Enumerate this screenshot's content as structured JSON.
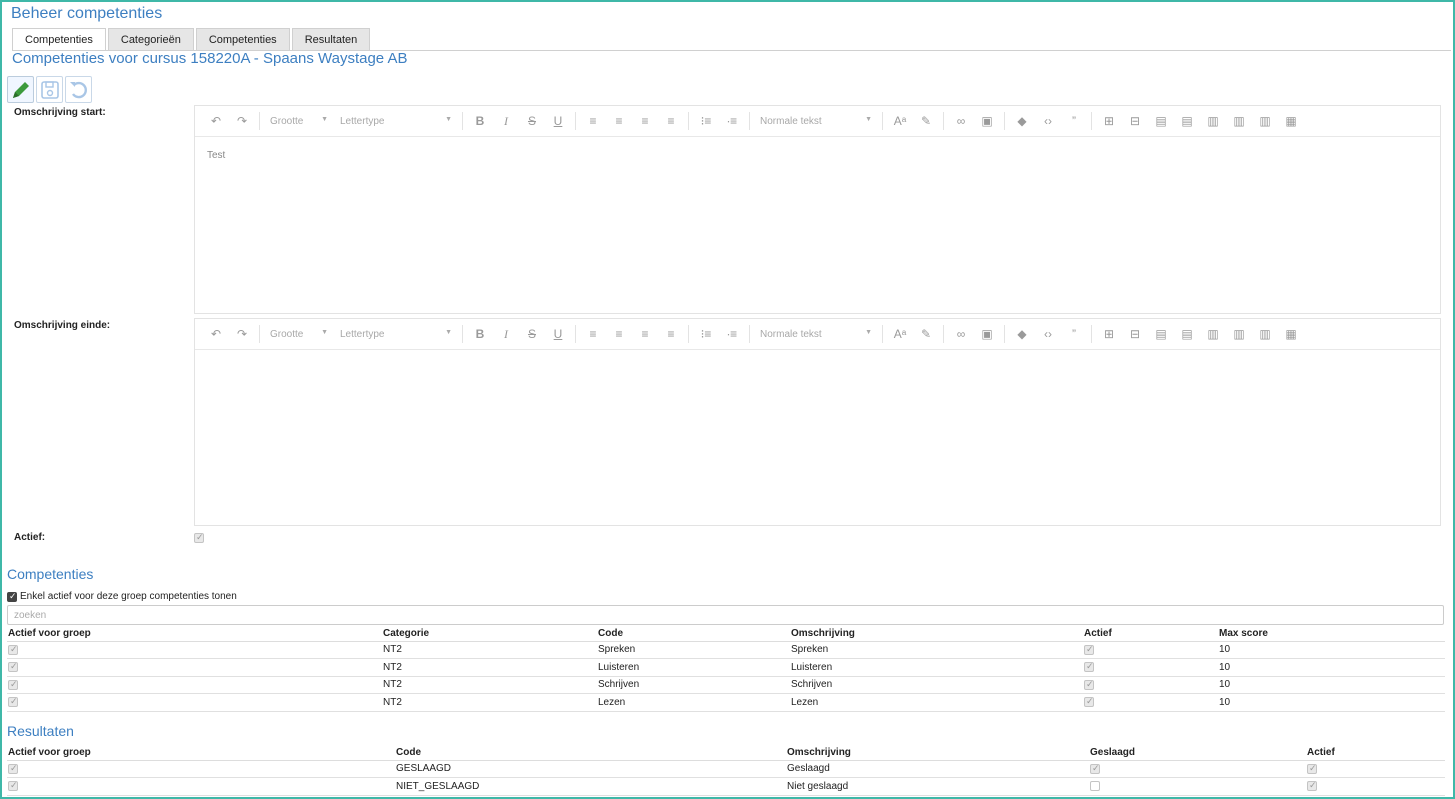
{
  "header": {
    "title": "Beheer competenties"
  },
  "tabs": [
    {
      "label": "Competenties",
      "active": true
    },
    {
      "label": "Categorieën",
      "active": false
    },
    {
      "label": "Competenties",
      "active": false
    },
    {
      "label": "Resultaten",
      "active": false
    }
  ],
  "subtitle": "Competenties voor cursus 158220A - Spaans Waystage AB",
  "toolbar": {
    "icons": [
      "pencil-icon",
      "save-icon",
      "undo-icon"
    ]
  },
  "form": {
    "start_label": "Omschrijving start:",
    "end_label": "Omschrijving einde:",
    "actief_label": "Actief:",
    "actief_checked": true,
    "editor": {
      "size_label": "Grootte",
      "font_label": "Lettertype",
      "style_label": "Normale tekst"
    },
    "start_text": "Test",
    "end_text": ""
  },
  "competenties": {
    "title": "Competenties",
    "filter_label": "Enkel actief voor deze groep competenties tonen",
    "filter_checked": true,
    "search_placeholder": "zoeken",
    "columns": [
      "Actief voor groep",
      "Categorie",
      "Code",
      "Omschrijving",
      "Actief",
      "Max score"
    ],
    "rows": [
      {
        "actief_groep": true,
        "categorie": "NT2",
        "code": "Spreken",
        "omschrijving": "Spreken",
        "actief": true,
        "max_score": "10"
      },
      {
        "actief_groep": true,
        "categorie": "NT2",
        "code": "Luisteren",
        "omschrijving": "Luisteren",
        "actief": true,
        "max_score": "10"
      },
      {
        "actief_groep": true,
        "categorie": "NT2",
        "code": "Schrijven",
        "omschrijving": "Schrijven",
        "actief": true,
        "max_score": "10"
      },
      {
        "actief_groep": true,
        "categorie": "NT2",
        "code": "Lezen",
        "omschrijving": "Lezen",
        "actief": true,
        "max_score": "10"
      }
    ]
  },
  "resultaten": {
    "title": "Resultaten",
    "columns": [
      "Actief voor groep",
      "Code",
      "Omschrijving",
      "Geslaagd",
      "Actief"
    ],
    "rows": [
      {
        "actief_groep": true,
        "code": "GESLAAGD",
        "omschrijving": "Geslaagd",
        "geslaagd": true,
        "actief": true
      },
      {
        "actief_groep": true,
        "code": "NIET_GESLAAGD",
        "omschrijving": "Niet geslaagd",
        "geslaagd": false,
        "actief": true
      }
    ]
  },
  "colors": {
    "accent": "#3d7fc1",
    "frame": "#3fb8a8",
    "edit_icon": "#3c9a3c"
  }
}
